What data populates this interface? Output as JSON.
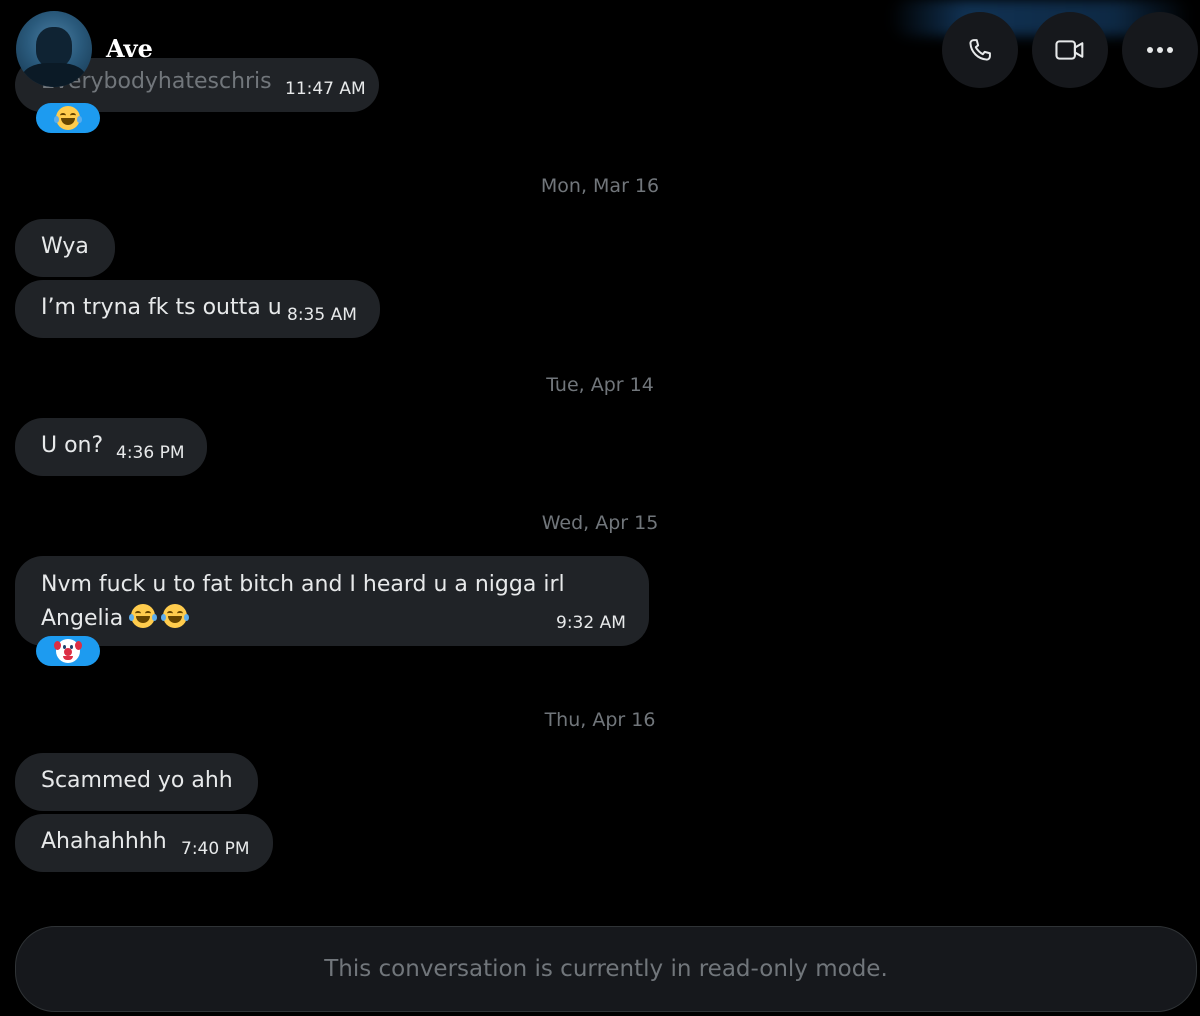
{
  "contact": {
    "name": "Ave"
  },
  "header_actions": {
    "call_icon": "phone-icon",
    "video_icon": "video-camera-icon",
    "more_icon": "more-horizontal-icon"
  },
  "colors": {
    "background": "#000000",
    "bubble": "#202327",
    "reaction": "#1d9bf0",
    "muted_text": "#71767b"
  },
  "messages": {
    "m0": {
      "text": "Everybodyhateschris",
      "time": "11:47 AM",
      "reaction": "face-with-tears-of-joy"
    },
    "date1": "Mon, Mar 16",
    "m1": {
      "text": "Wya"
    },
    "m2": {
      "text": "I’m tryna fk ts outta u",
      "time": "8:35 AM"
    },
    "date2": "Tue, Apr 14",
    "m3": {
      "text": "U on?",
      "time": "4:36 PM"
    },
    "date3": "Wed, Apr 15",
    "m4": {
      "line1": "Nvm fuck u to fat bitch and I heard u a nigga irl",
      "line2": "Angelia",
      "time": "9:32 AM",
      "inline_emojis": [
        "face-with-tears-of-joy",
        "face-with-tears-of-joy"
      ],
      "reaction": "clown-face"
    },
    "date4": "Thu, Apr 16",
    "m5": {
      "text": "Scammed yo ahh"
    },
    "m6": {
      "text": "Ahahahhhh",
      "time": "7:40 PM"
    }
  },
  "composer": {
    "readonly_text": "This conversation is currently in read-only mode."
  }
}
